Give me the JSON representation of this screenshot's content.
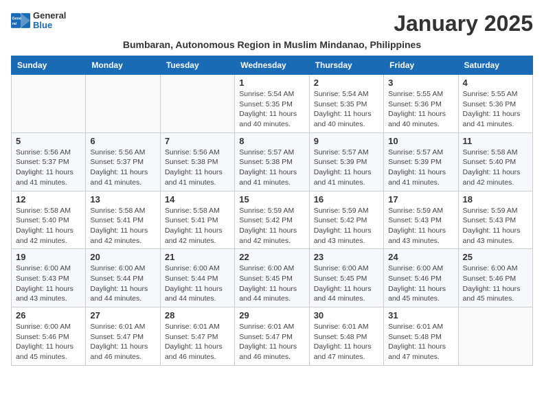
{
  "logo": {
    "text_general": "General",
    "text_blue": "Blue"
  },
  "title": "January 2025",
  "subtitle": "Bumbaran, Autonomous Region in Muslim Mindanao, Philippines",
  "headers": [
    "Sunday",
    "Monday",
    "Tuesday",
    "Wednesday",
    "Thursday",
    "Friday",
    "Saturday"
  ],
  "weeks": [
    [
      {
        "day": "",
        "sunrise": "",
        "sunset": "",
        "daylight": ""
      },
      {
        "day": "",
        "sunrise": "",
        "sunset": "",
        "daylight": ""
      },
      {
        "day": "",
        "sunrise": "",
        "sunset": "",
        "daylight": ""
      },
      {
        "day": "1",
        "sunrise": "Sunrise: 5:54 AM",
        "sunset": "Sunset: 5:35 PM",
        "daylight": "Daylight: 11 hours and 40 minutes."
      },
      {
        "day": "2",
        "sunrise": "Sunrise: 5:54 AM",
        "sunset": "Sunset: 5:35 PM",
        "daylight": "Daylight: 11 hours and 40 minutes."
      },
      {
        "day": "3",
        "sunrise": "Sunrise: 5:55 AM",
        "sunset": "Sunset: 5:36 PM",
        "daylight": "Daylight: 11 hours and 40 minutes."
      },
      {
        "day": "4",
        "sunrise": "Sunrise: 5:55 AM",
        "sunset": "Sunset: 5:36 PM",
        "daylight": "Daylight: 11 hours and 41 minutes."
      }
    ],
    [
      {
        "day": "5",
        "sunrise": "Sunrise: 5:56 AM",
        "sunset": "Sunset: 5:37 PM",
        "daylight": "Daylight: 11 hours and 41 minutes."
      },
      {
        "day": "6",
        "sunrise": "Sunrise: 5:56 AM",
        "sunset": "Sunset: 5:37 PM",
        "daylight": "Daylight: 11 hours and 41 minutes."
      },
      {
        "day": "7",
        "sunrise": "Sunrise: 5:56 AM",
        "sunset": "Sunset: 5:38 PM",
        "daylight": "Daylight: 11 hours and 41 minutes."
      },
      {
        "day": "8",
        "sunrise": "Sunrise: 5:57 AM",
        "sunset": "Sunset: 5:38 PM",
        "daylight": "Daylight: 11 hours and 41 minutes."
      },
      {
        "day": "9",
        "sunrise": "Sunrise: 5:57 AM",
        "sunset": "Sunset: 5:39 PM",
        "daylight": "Daylight: 11 hours and 41 minutes."
      },
      {
        "day": "10",
        "sunrise": "Sunrise: 5:57 AM",
        "sunset": "Sunset: 5:39 PM",
        "daylight": "Daylight: 11 hours and 41 minutes."
      },
      {
        "day": "11",
        "sunrise": "Sunrise: 5:58 AM",
        "sunset": "Sunset: 5:40 PM",
        "daylight": "Daylight: 11 hours and 42 minutes."
      }
    ],
    [
      {
        "day": "12",
        "sunrise": "Sunrise: 5:58 AM",
        "sunset": "Sunset: 5:40 PM",
        "daylight": "Daylight: 11 hours and 42 minutes."
      },
      {
        "day": "13",
        "sunrise": "Sunrise: 5:58 AM",
        "sunset": "Sunset: 5:41 PM",
        "daylight": "Daylight: 11 hours and 42 minutes."
      },
      {
        "day": "14",
        "sunrise": "Sunrise: 5:58 AM",
        "sunset": "Sunset: 5:41 PM",
        "daylight": "Daylight: 11 hours and 42 minutes."
      },
      {
        "day": "15",
        "sunrise": "Sunrise: 5:59 AM",
        "sunset": "Sunset: 5:42 PM",
        "daylight": "Daylight: 11 hours and 42 minutes."
      },
      {
        "day": "16",
        "sunrise": "Sunrise: 5:59 AM",
        "sunset": "Sunset: 5:42 PM",
        "daylight": "Daylight: 11 hours and 43 minutes."
      },
      {
        "day": "17",
        "sunrise": "Sunrise: 5:59 AM",
        "sunset": "Sunset: 5:43 PM",
        "daylight": "Daylight: 11 hours and 43 minutes."
      },
      {
        "day": "18",
        "sunrise": "Sunrise: 5:59 AM",
        "sunset": "Sunset: 5:43 PM",
        "daylight": "Daylight: 11 hours and 43 minutes."
      }
    ],
    [
      {
        "day": "19",
        "sunrise": "Sunrise: 6:00 AM",
        "sunset": "Sunset: 5:43 PM",
        "daylight": "Daylight: 11 hours and 43 minutes."
      },
      {
        "day": "20",
        "sunrise": "Sunrise: 6:00 AM",
        "sunset": "Sunset: 5:44 PM",
        "daylight": "Daylight: 11 hours and 44 minutes."
      },
      {
        "day": "21",
        "sunrise": "Sunrise: 6:00 AM",
        "sunset": "Sunset: 5:44 PM",
        "daylight": "Daylight: 11 hours and 44 minutes."
      },
      {
        "day": "22",
        "sunrise": "Sunrise: 6:00 AM",
        "sunset": "Sunset: 5:45 PM",
        "daylight": "Daylight: 11 hours and 44 minutes."
      },
      {
        "day": "23",
        "sunrise": "Sunrise: 6:00 AM",
        "sunset": "Sunset: 5:45 PM",
        "daylight": "Daylight: 11 hours and 44 minutes."
      },
      {
        "day": "24",
        "sunrise": "Sunrise: 6:00 AM",
        "sunset": "Sunset: 5:46 PM",
        "daylight": "Daylight: 11 hours and 45 minutes."
      },
      {
        "day": "25",
        "sunrise": "Sunrise: 6:00 AM",
        "sunset": "Sunset: 5:46 PM",
        "daylight": "Daylight: 11 hours and 45 minutes."
      }
    ],
    [
      {
        "day": "26",
        "sunrise": "Sunrise: 6:00 AM",
        "sunset": "Sunset: 5:46 PM",
        "daylight": "Daylight: 11 hours and 45 minutes."
      },
      {
        "day": "27",
        "sunrise": "Sunrise: 6:01 AM",
        "sunset": "Sunset: 5:47 PM",
        "daylight": "Daylight: 11 hours and 46 minutes."
      },
      {
        "day": "28",
        "sunrise": "Sunrise: 6:01 AM",
        "sunset": "Sunset: 5:47 PM",
        "daylight": "Daylight: 11 hours and 46 minutes."
      },
      {
        "day": "29",
        "sunrise": "Sunrise: 6:01 AM",
        "sunset": "Sunset: 5:47 PM",
        "daylight": "Daylight: 11 hours and 46 minutes."
      },
      {
        "day": "30",
        "sunrise": "Sunrise: 6:01 AM",
        "sunset": "Sunset: 5:48 PM",
        "daylight": "Daylight: 11 hours and 47 minutes."
      },
      {
        "day": "31",
        "sunrise": "Sunrise: 6:01 AM",
        "sunset": "Sunset: 5:48 PM",
        "daylight": "Daylight: 11 hours and 47 minutes."
      },
      {
        "day": "",
        "sunrise": "",
        "sunset": "",
        "daylight": ""
      }
    ]
  ]
}
